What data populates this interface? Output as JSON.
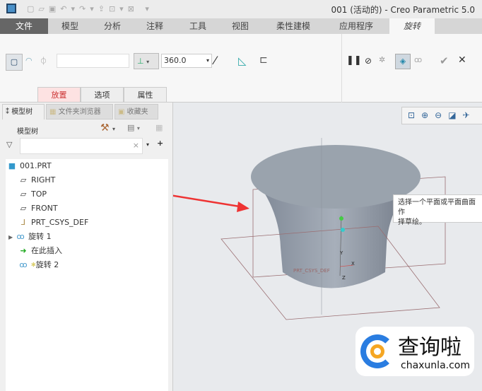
{
  "window": {
    "title": "001 (活动的) - Creo Parametric 5.0"
  },
  "tabs": [
    {
      "label": "文件"
    },
    {
      "label": "模型"
    },
    {
      "label": "分析"
    },
    {
      "label": "注释"
    },
    {
      "label": "工具"
    },
    {
      "label": "视图"
    },
    {
      "label": "柔性建模"
    },
    {
      "label": "应用程序"
    },
    {
      "label": "旋转"
    }
  ],
  "ribbon": {
    "angle_value": "360.0",
    "subtabs": [
      {
        "label": "放置"
      },
      {
        "label": "选项"
      },
      {
        "label": "属性"
      }
    ]
  },
  "panel": {
    "tabs": [
      {
        "label": "模型树"
      },
      {
        "label": "文件夹浏览器"
      },
      {
        "label": "收藏夹"
      }
    ],
    "header": "模型树",
    "search_placeholder": ""
  },
  "tree": [
    {
      "label": "001.PRT"
    },
    {
      "label": "RIGHT"
    },
    {
      "label": "TOP"
    },
    {
      "label": "FRONT"
    },
    {
      "label": "PRT_CSYS_DEF"
    },
    {
      "label": "旋转 1"
    },
    {
      "label": "在此插入"
    },
    {
      "label": "旋转 2"
    }
  ],
  "viewport": {
    "tooltip": "选择一个平面或平面曲面作为草绘平面，或者选择草绘。",
    "tooltip_line1": "选择一个平面或平面曲面作",
    "tooltip_line2": "择草绘。",
    "csys_label": "PRT_CSYS_DEF",
    "axis_x": "X",
    "axis_y": "Y",
    "axis_z": "Z"
  },
  "watermark": {
    "text": "查询啦",
    "url": "chaxunla.com"
  }
}
